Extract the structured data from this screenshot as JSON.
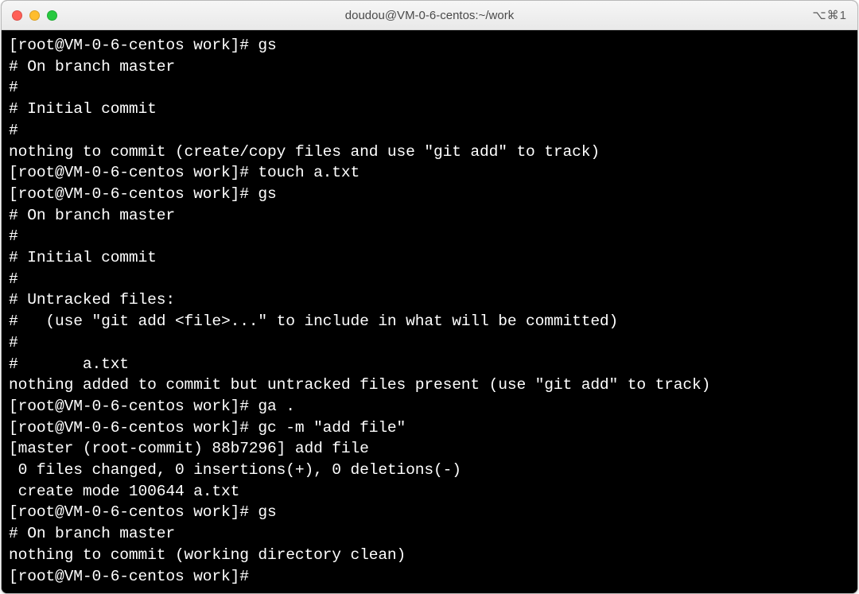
{
  "window": {
    "title": "doudou@VM-0-6-centos:~/work",
    "shortcut": "⌥⌘1"
  },
  "prompt": "[root@VM-0-6-centos work]#",
  "lines": [
    "[root@VM-0-6-centos work]# gs",
    "# On branch master",
    "#",
    "# Initial commit",
    "#",
    "nothing to commit (create/copy files and use \"git add\" to track)",
    "[root@VM-0-6-centos work]# touch a.txt",
    "[root@VM-0-6-centos work]# gs",
    "# On branch master",
    "#",
    "# Initial commit",
    "#",
    "# Untracked files:",
    "#   (use \"git add <file>...\" to include in what will be committed)",
    "#",
    "#       a.txt",
    "nothing added to commit but untracked files present (use \"git add\" to track)",
    "[root@VM-0-6-centos work]# ga .",
    "[root@VM-0-6-centos work]# gc -m \"add file\"",
    "[master (root-commit) 88b7296] add file",
    " 0 files changed, 0 insertions(+), 0 deletions(-)",
    " create mode 100644 a.txt",
    "[root@VM-0-6-centos work]# gs",
    "# On branch master",
    "nothing to commit (working directory clean)",
    "[root@VM-0-6-centos work]# "
  ]
}
